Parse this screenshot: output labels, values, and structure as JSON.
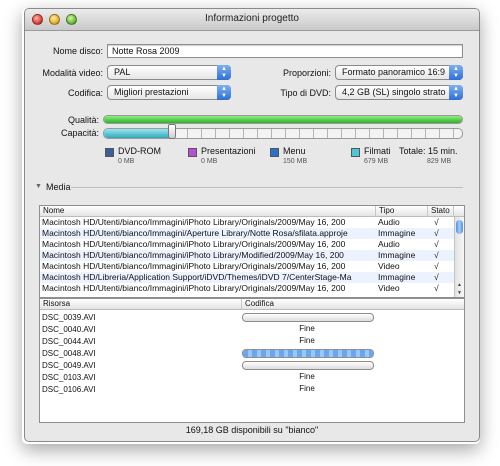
{
  "window": {
    "title": "Informazioni progetto"
  },
  "form": {
    "disc_name_label": "Nome disco:",
    "disc_name_value": "Notte Rosa 2009",
    "video_mode_label": "Modalità video:",
    "video_mode_value": "PAL",
    "proportions_label": "Proporzioni:",
    "proportions_value": "Formato panoramico 16:9",
    "encoding_label": "Codifica:",
    "encoding_value": "Migliori prestazioni",
    "dvd_type_label": "Tipo di DVD:",
    "dvd_type_value": "4,2 GB (SL) singolo strato"
  },
  "meters": {
    "quality_label": "Qualità:",
    "quality_fraction": 1.0,
    "capacity_label": "Capacità:",
    "capacity_fraction": 0.19,
    "colors": {
      "quality": "#3ec43a",
      "capacity": "#4fc6d6"
    }
  },
  "legend": [
    {
      "name": "DVD-ROM",
      "size": "0 MB",
      "color": "#3b5f9a"
    },
    {
      "name": "Presentazioni",
      "size": "0 MB",
      "color": "#b84fd6"
    },
    {
      "name": "Menu",
      "size": "150 MB",
      "color": "#2a72c8"
    },
    {
      "name": "Filmati",
      "size": "679 MB",
      "color": "#4fc6d6"
    }
  ],
  "total": {
    "label": "Totale: 15 min.",
    "size": "829 MB"
  },
  "media_section": {
    "label": "Media"
  },
  "media_table": {
    "columns": [
      "Nome",
      "Tipo",
      "Stato"
    ],
    "rows": [
      {
        "name": "Macintosh HD/Utenti/bianco/Immagini/iPhoto Library/Originals/2009/May 16, 200",
        "type": "Audio",
        "status": "√"
      },
      {
        "name": "Macintosh HD/Utenti/bianco/Immagini/Aperture Library/Notte Rosa/sfilata.approje",
        "type": "Immagine",
        "status": "√"
      },
      {
        "name": "Macintosh HD/Utenti/bianco/Immagini/iPhoto Library/Originals/2009/May 16, 200",
        "type": "Audio",
        "status": "√"
      },
      {
        "name": "Macintosh HD/Utenti/bianco/Immagini/iPhoto Library/Modified/2009/May 16, 200",
        "type": "Immagine",
        "status": "√"
      },
      {
        "name": "Macintosh HD/Utenti/bianco/Immagini/iPhoto Library/Originals/2009/May 16, 200",
        "type": "Video",
        "status": "√"
      },
      {
        "name": "Macintosh HD/Libreria/Application Support/iDVD/Themes/iDVD 7/CenterStage-Ma",
        "type": "Immagine",
        "status": "√"
      },
      {
        "name": "Macintosh HD/Utenti/bianco/Immagini/iPhoto Library/Originals/2009/May 16, 200",
        "type": "Video",
        "status": "√"
      }
    ]
  },
  "resource_table": {
    "columns": [
      "Risorsa",
      "Codifica"
    ],
    "rows": [
      {
        "name": "DSC_0039.AVI",
        "status": "",
        "progress": 0.0,
        "bar": true
      },
      {
        "name": "DSC_0040.AVI",
        "status": "Fine",
        "bar": false
      },
      {
        "name": "DSC_0044.AVI",
        "status": "Fine",
        "bar": false
      },
      {
        "name": "DSC_0048.AVI",
        "status": "",
        "progress": 1.0,
        "bar": true
      },
      {
        "name": "DSC_0049.AVI",
        "status": "",
        "progress": 0.0,
        "bar": true
      },
      {
        "name": "DSC_0103.AVI",
        "status": "Fine",
        "bar": false
      },
      {
        "name": "DSC_0106.AVI",
        "status": "Fine",
        "bar": false
      }
    ]
  },
  "footer": {
    "text": "169,18 GB disponibili su \"bianco\""
  }
}
